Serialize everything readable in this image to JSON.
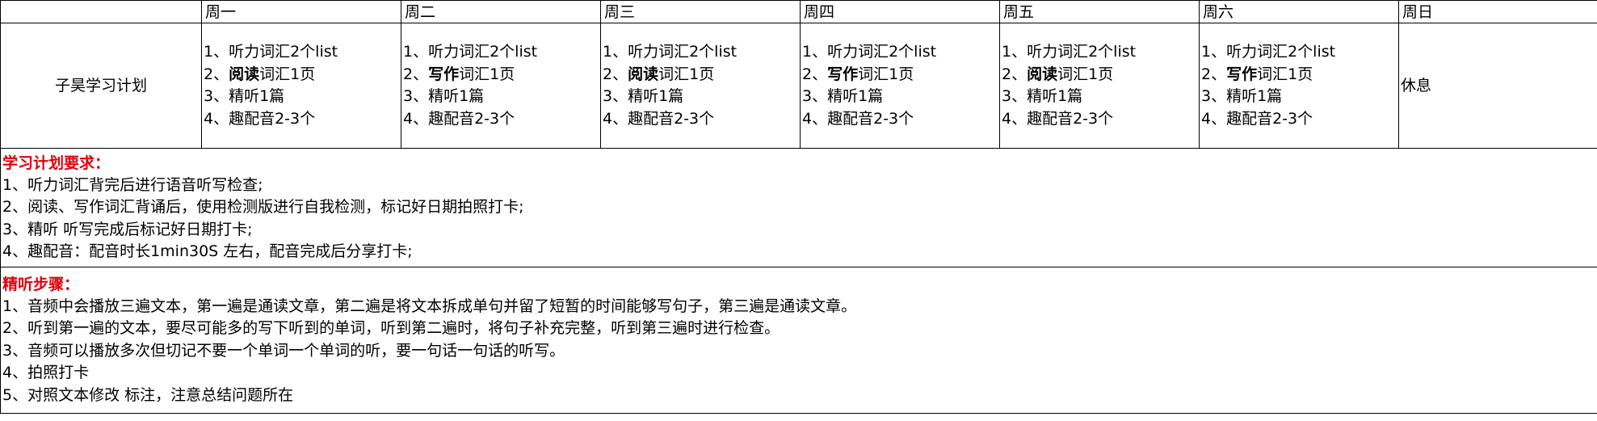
{
  "header": {
    "days": [
      "周一",
      "周二",
      "周三",
      "周四",
      "周五",
      "周六",
      "周日"
    ]
  },
  "plan": {
    "title": "子昊学习计划",
    "days": [
      {
        "l1": "1、听力词汇2个list",
        "l2a": "2、",
        "l2b": "阅读",
        "l2c": "词汇1页",
        "l3": "3、精听1篇",
        "l4": "4、趣配音2-3个"
      },
      {
        "l1": "1、听力词汇2个list",
        "l2a": "2、",
        "l2b": "写作",
        "l2c": "词汇1页",
        "l3": "3、精听1篇",
        "l4": "4、趣配音2-3个"
      },
      {
        "l1": "1、听力词汇2个list",
        "l2a": "2、",
        "l2b": "阅读",
        "l2c": "词汇1页",
        "l3": "3、精听1篇",
        "l4": "4、趣配音2-3个"
      },
      {
        "l1": "1、听力词汇2个list",
        "l2a": "2、",
        "l2b": "写作",
        "l2c": "词汇1页",
        "l3": "3、精听1篇",
        "l4": "4、趣配音2-3个"
      },
      {
        "l1": "1、听力词汇2个list",
        "l2a": "2、",
        "l2b": "阅读",
        "l2c": "词汇1页",
        "l3": "3、精听1篇",
        "l4": "4、趣配音2-3个"
      },
      {
        "l1": "1、听力词汇2个list",
        "l2a": "2、",
        "l2b": "写作",
        "l2c": "词汇1页",
        "l3": "3、精听1篇",
        "l4": "4、趣配音2-3个"
      }
    ],
    "sunday": "休息"
  },
  "requirements": {
    "title": "学习计划要求：",
    "lines": [
      "1、听力词汇背完后进行语音听写检查;",
      "2、阅读、写作词汇背诵后，使用检测版进行自我检测，标记好日期拍照打卡;",
      "3、精听 听写完成后标记好日期打卡;",
      "4、趣配音：配音时长1min30S 左右，配音完成后分享打卡;"
    ]
  },
  "steps": {
    "title": "精听步骤：",
    "lines": [
      "1、音频中会播放三遍文本，第一遍是通读文章，第二遍是将文本拆成单句并留了短暂的时间能够写句子，第三遍是通读文章。",
      "2、听到第一遍的文本，要尽可能多的写下听到的单词，听到第二遍时，将句子补充完整，听到第三遍时进行检查。",
      "3、音频可以播放多次但切记不要一个单词一个单词的听，要一句话一句话的听写。",
      "4、拍照打卡",
      "5、对照文本修改 标注，注意总结问题所在"
    ]
  }
}
